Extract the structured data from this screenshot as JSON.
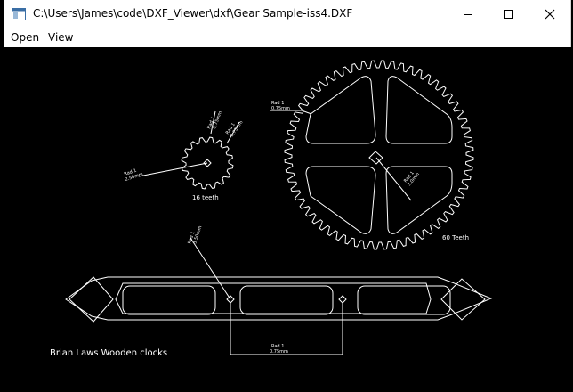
{
  "window": {
    "title": "C:\\Users\\James\\code\\DXF_Viewer\\dxf\\Gear Sample-iss4.DXF",
    "icon": "app-window-icon"
  },
  "caption_buttons": {
    "minimize": "minimize-icon",
    "maximize": "maximize-icon",
    "close": "close-icon"
  },
  "menu": {
    "items": [
      {
        "label": "Open"
      },
      {
        "label": "View"
      }
    ]
  },
  "drawing": {
    "colors": {
      "background": "#000000",
      "stroke": "#ffffff"
    },
    "large_gear": {
      "label": "60 Teeth",
      "teeth": 60
    },
    "small_gear": {
      "label": "16 teeth",
      "teeth": 16
    },
    "footer_text": "Brian Laws Wooden clocks"
  }
}
